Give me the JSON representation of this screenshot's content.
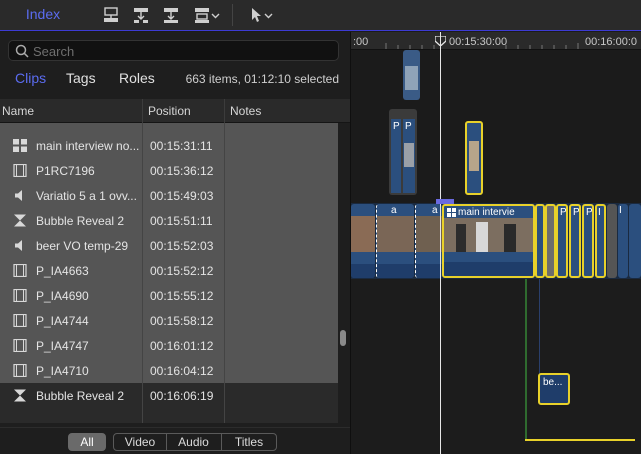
{
  "toolbar": {
    "index_label": "Index",
    "accent_color": "#5b6cf0"
  },
  "search": {
    "placeholder": "Search"
  },
  "tabs": {
    "clips": "Clips",
    "tags": "Tags",
    "roles": "Roles"
  },
  "summary": "663 items, 01:12:10 selected",
  "columns": {
    "name": "Name",
    "position": "Position",
    "notes": "Notes"
  },
  "rows": [
    {
      "icon": "multicam-icon",
      "name": "main interview no...",
      "position": "00:15:31:11"
    },
    {
      "icon": "film-icon",
      "name": "P1RC7196",
      "position": "00:15:36:12"
    },
    {
      "icon": "audio-icon",
      "name": "Variatio 5 a 1 ovv...",
      "position": "00:15:49:03"
    },
    {
      "icon": "generator-icon",
      "name": "Bubble Reveal 2",
      "position": "00:15:51:11"
    },
    {
      "icon": "audio-icon",
      "name": "beer VO temp-29",
      "position": "00:15:52:03"
    },
    {
      "icon": "film-icon",
      "name": "P_IA4663",
      "position": "00:15:52:12"
    },
    {
      "icon": "film-icon",
      "name": "P_IA4690",
      "position": "00:15:55:12"
    },
    {
      "icon": "film-icon",
      "name": "P_IA4744",
      "position": "00:15:58:12"
    },
    {
      "icon": "film-icon",
      "name": "P_IA4747",
      "position": "00:16:01:12"
    },
    {
      "icon": "film-icon",
      "name": "P_IA4710",
      "position": "00:16:04:12"
    },
    {
      "icon": "generator-icon",
      "name": "Bubble Reveal 2",
      "position": "00:16:06:19"
    }
  ],
  "filters": {
    "all": "All",
    "video": "Video",
    "audio": "Audio",
    "titles": "Titles"
  },
  "timeline": {
    "ruler_left": ":00",
    "ruler_mid": "00:15:30:00",
    "ruler_right": "00:16:00:0",
    "main_clip_label": "main intervie",
    "small_clip_a": "a",
    "small_clip_b": "a",
    "top_clip_p1": "P",
    "top_clip_p2": "P",
    "bottom_clip_label": "be...",
    "tiny_labels": [
      "P",
      "P",
      "P",
      "I",
      "I"
    ],
    "selection_color": "#e8d12a"
  }
}
